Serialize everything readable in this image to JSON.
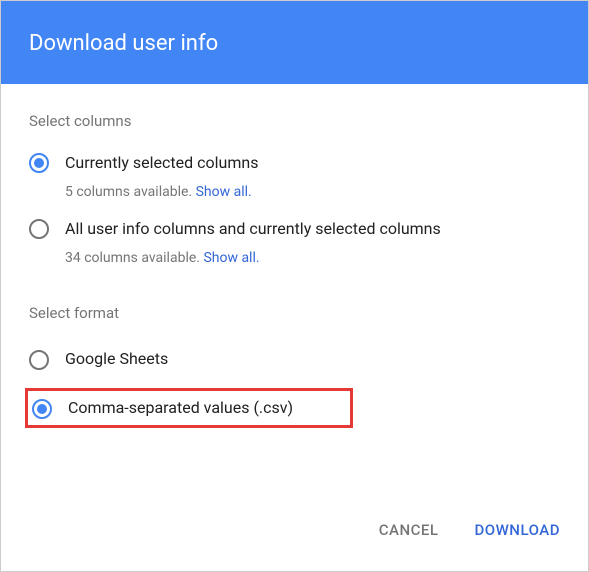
{
  "header": {
    "title": "Download user info"
  },
  "sections": {
    "columns": {
      "label": "Select columns",
      "options": [
        {
          "label": "Currently selected columns",
          "sublabel_prefix": "5 columns available. ",
          "show_all": "Show all."
        },
        {
          "label": "All user info columns and currently selected columns",
          "sublabel_prefix": "34 columns available. ",
          "show_all": "Show all."
        }
      ]
    },
    "format": {
      "label": "Select format",
      "options": [
        {
          "label": "Google Sheets"
        },
        {
          "label": "Comma-separated values (.csv)"
        }
      ]
    }
  },
  "footer": {
    "cancel": "CANCEL",
    "download": "DOWNLOAD"
  }
}
